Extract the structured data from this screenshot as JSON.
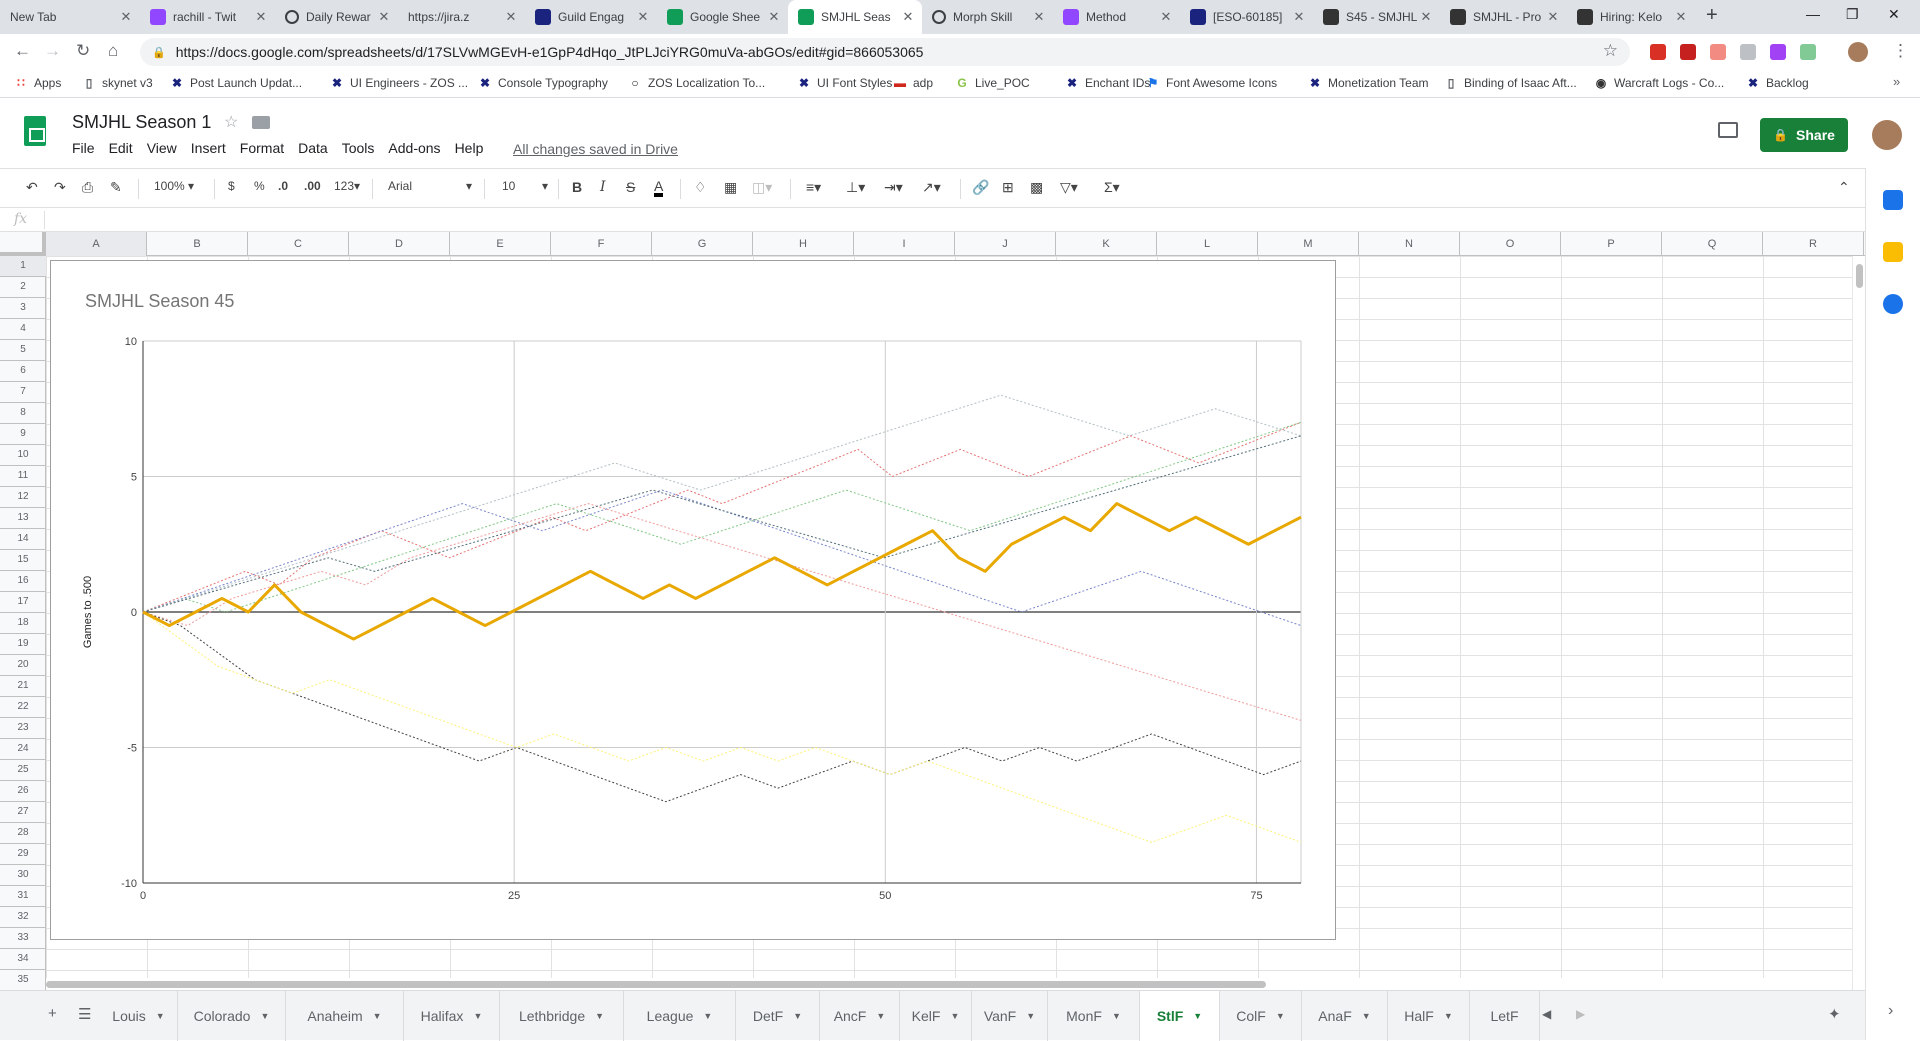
{
  "browser": {
    "tabs": [
      {
        "title": "New Tab",
        "icon": "none-icon",
        "color": ""
      },
      {
        "title": "rachill - Twit",
        "icon": "twitch-icon",
        "color": "#9146ff"
      },
      {
        "title": "Daily Rewar",
        "icon": "circle-icon",
        "color": ""
      },
      {
        "title": "https://jira.z",
        "icon": "page-icon",
        "color": ""
      },
      {
        "title": "Guild Engag",
        "icon": "zos-icon",
        "color": "#1a237e"
      },
      {
        "title": "Google Shee",
        "icon": "sheets-icon",
        "color": "#0f9d58"
      },
      {
        "title": "SMJHL Seas",
        "icon": "sheets-icon",
        "color": "#0f9d58"
      },
      {
        "title": "Morph Skill",
        "icon": "circle-icon",
        "color": ""
      },
      {
        "title": "Method",
        "icon": "twitch-icon",
        "color": "#9146ff"
      },
      {
        "title": "[ESO-60185]",
        "icon": "zos-icon",
        "color": "#1a237e"
      },
      {
        "title": "S45 - SMJHL",
        "icon": "shield-icon",
        "color": "#333"
      },
      {
        "title": "SMJHL - Pro",
        "icon": "shield-icon",
        "color": "#333"
      },
      {
        "title": "Hiring: Kelo",
        "icon": "shield-icon",
        "color": "#333"
      }
    ],
    "active_tab": 6,
    "new_tab": "+",
    "url": "https://docs.google.com/spreadsheets/d/17SLVwMGEvH-e1GpP4dHqo_JtPLJciYRG0muVa-abGOs/edit#gid=866053065",
    "bookmarks": [
      {
        "label": "Apps",
        "icon": "apps-icon",
        "color": "#ea4335"
      },
      {
        "label": "skynet v3",
        "icon": "page-icon",
        "color": "#5f6368"
      },
      {
        "label": "Post Launch Updat...",
        "icon": "zos-icon",
        "color": "#1a237e"
      },
      {
        "label": "UI Engineers - ZOS ...",
        "icon": "zos-icon",
        "color": "#1a237e"
      },
      {
        "label": "Console Typography",
        "icon": "zos-icon",
        "color": "#1a237e"
      },
      {
        "label": "ZOS Localization To...",
        "icon": "circle-icon",
        "color": "#202124"
      },
      {
        "label": "UI Font Styles",
        "icon": "zos-icon",
        "color": "#1a237e"
      },
      {
        "label": "adp",
        "icon": "adp-icon",
        "color": "#d0271d"
      },
      {
        "label": "Live_POC",
        "icon": "g-icon",
        "color": "#8bc34a"
      },
      {
        "label": "Enchant IDs",
        "icon": "zos-icon",
        "color": "#1a237e"
      },
      {
        "label": "Font Awesome Icons",
        "icon": "flag-icon",
        "color": "#1a73e8"
      },
      {
        "label": "Monetization Team",
        "icon": "zos-icon",
        "color": "#1a237e"
      },
      {
        "label": "Binding of Isaac Aft...",
        "icon": "page-icon",
        "color": "#5f6368"
      },
      {
        "label": "Warcraft Logs - Co...",
        "icon": "wcl-icon",
        "color": "#333"
      },
      {
        "label": "Backlog",
        "icon": "zos-icon",
        "color": "#1a237e"
      }
    ]
  },
  "sheets": {
    "title": "SMJHL Season 1",
    "menus": [
      "File",
      "Edit",
      "View",
      "Insert",
      "Format",
      "Data",
      "Tools",
      "Add-ons",
      "Help"
    ],
    "saved_status": "All changes saved in Drive",
    "share_label": "Share",
    "toolbar": {
      "zoom": "100%",
      "currency": "$",
      "percent": "%",
      "dec_decrease": ".0",
      "dec_increase": ".00",
      "more_formats": "123",
      "font": "Arial",
      "font_size": "10",
      "bold": "B",
      "italic": "I",
      "strike": "S",
      "text_color": "A"
    },
    "fx_label": "fx",
    "columns": [
      "A",
      "B",
      "C",
      "D",
      "E",
      "F",
      "G",
      "H",
      "I",
      "J",
      "K",
      "L",
      "M",
      "N",
      "O",
      "P",
      "Q",
      "R"
    ],
    "rows": [
      "1",
      "2",
      "3",
      "4",
      "5",
      "6",
      "7",
      "8",
      "9",
      "10",
      "11",
      "12",
      "13",
      "14",
      "15",
      "16",
      "17",
      "18",
      "19",
      "20",
      "21",
      "22",
      "23",
      "24",
      "25",
      "26",
      "27",
      "28",
      "29",
      "30",
      "31",
      "32",
      "33",
      "34",
      "35"
    ],
    "sheet_tabs": [
      {
        "label": "Louis"
      },
      {
        "label": "Colorado"
      },
      {
        "label": "Anaheim"
      },
      {
        "label": "Halifax"
      },
      {
        "label": "Lethbridge"
      },
      {
        "label": "League"
      },
      {
        "label": "DetF"
      },
      {
        "label": "AncF"
      },
      {
        "label": "KelF"
      },
      {
        "label": "VanF"
      },
      {
        "label": "MonF"
      },
      {
        "label": "StlF"
      },
      {
        "label": "ColF"
      },
      {
        "label": "AnaF"
      },
      {
        "label": "HalF"
      },
      {
        "label": "LetF"
      }
    ],
    "active_sheet": 11
  },
  "chart_data": {
    "type": "line",
    "title": "SMJHL Season 45",
    "xlabel": "",
    "ylabel": "Games to .500",
    "xlim": [
      0,
      78
    ],
    "ylim": [
      -10,
      10
    ],
    "xticks": [
      0,
      25,
      50,
      75
    ],
    "yticks": [
      -10,
      -5,
      0,
      5,
      10
    ],
    "grid": true,
    "legend": "none",
    "series": [
      {
        "color": "#e8a800",
        "width": 3,
        "values": [
          0,
          -0.5,
          0,
          0.5,
          0,
          1,
          0,
          -0.5,
          -1,
          -0.5,
          0,
          0.5,
          0,
          -0.5,
          0,
          0.5,
          1,
          1.5,
          1,
          0.5,
          1,
          0.5,
          1,
          1.5,
          2,
          1.5,
          1,
          1.5,
          2,
          2.5,
          3,
          2,
          1.5,
          2.5,
          3,
          3.5,
          3,
          4,
          3.5,
          3,
          3.5,
          3,
          2.5,
          3,
          3.5
        ]
      },
      {
        "color": "#e57373",
        "width": 1,
        "values": [
          0,
          0.5,
          1,
          1.5,
          1,
          2,
          2.5,
          3,
          2.5,
          2,
          2.5,
          3,
          3.5,
          3,
          3.5,
          4,
          4.5,
          4,
          4.5,
          5,
          5.5,
          6,
          5,
          5.5,
          6,
          5.5,
          5,
          5.5,
          6,
          6.5,
          6,
          5.5,
          6,
          6.5,
          7
        ]
      },
      {
        "color": "#81c784",
        "width": 1,
        "values": [
          0,
          0.5,
          0,
          0.5,
          1,
          1.5,
          2,
          2.5,
          3,
          3.5,
          4,
          3.5,
          3,
          2.5,
          3,
          3.5,
          4,
          4.5,
          4,
          3.5,
          3,
          3.5,
          4,
          4.5,
          5,
          5.5,
          6,
          6.5,
          7
        ]
      },
      {
        "color": "#7986cb",
        "width": 1,
        "values": [
          0,
          0.5,
          1,
          1.5,
          2,
          2.5,
          3,
          3.5,
          4,
          3.5,
          3,
          3.5,
          4,
          4.5,
          4,
          3.5,
          3,
          2.5,
          2,
          1.5,
          1,
          0.5,
          0,
          0.5,
          1,
          1.5,
          1,
          0.5,
          0,
          -0.5
        ]
      },
      {
        "color": "#ef9a9a",
        "width": 1,
        "values": [
          0,
          -0.5,
          0.5,
          1,
          1.5,
          1,
          2,
          2.5,
          3,
          3.5,
          4,
          3.5,
          3,
          2.5,
          2,
          1.5,
          1,
          0.5,
          0,
          -0.5,
          -1,
          -1.5,
          -2,
          -2.5,
          -3,
          -3.5,
          -4
        ]
      },
      {
        "color": "#b0bec5",
        "width": 1,
        "values": [
          0,
          0.5,
          1,
          1.5,
          2,
          2.5,
          3,
          3.5,
          4,
          4.5,
          5,
          5.5,
          5,
          4.5,
          5,
          5.5,
          6,
          6.5,
          7,
          7.5,
          8,
          7.5,
          7,
          6.5,
          7,
          7.5,
          7,
          6.5
        ]
      },
      {
        "color": "#546e7a",
        "width": 1,
        "values": [
          0,
          0.5,
          1,
          1.5,
          2,
          1.5,
          2,
          2.5,
          3,
          3.5,
          4,
          4.5,
          4,
          3.5,
          3,
          2.5,
          2,
          2.5,
          3,
          3.5,
          4,
          4.5,
          5,
          5.5,
          6,
          6.5
        ]
      },
      {
        "color": "#424242",
        "width": 1,
        "values": [
          0,
          -0.5,
          -1.5,
          -2.5,
          -3,
          -3.5,
          -4,
          -4.5,
          -5,
          -5.5,
          -5,
          -5.5,
          -6,
          -6.5,
          -7,
          -6.5,
          -6,
          -6.5,
          -6,
          -5.5,
          -6,
          -5.5,
          -5,
          -5.5,
          -5,
          -5.5,
          -5,
          -4.5,
          -5,
          -5.5,
          -6,
          -5.5
        ]
      },
      {
        "color": "#fff176",
        "width": 1,
        "values": [
          0,
          -1,
          -2,
          -2.5,
          -3,
          -2.5,
          -3,
          -3.5,
          -4,
          -4.5,
          -5,
          -4.5,
          -5,
          -5.5,
          -5,
          -5.5,
          -5,
          -5.5,
          -5,
          -5.5,
          -6,
          -5.5,
          -6,
          -6.5,
          -7,
          -7.5,
          -8,
          -8.5,
          -8,
          -7.5,
          -8,
          -8.5
        ]
      }
    ]
  }
}
